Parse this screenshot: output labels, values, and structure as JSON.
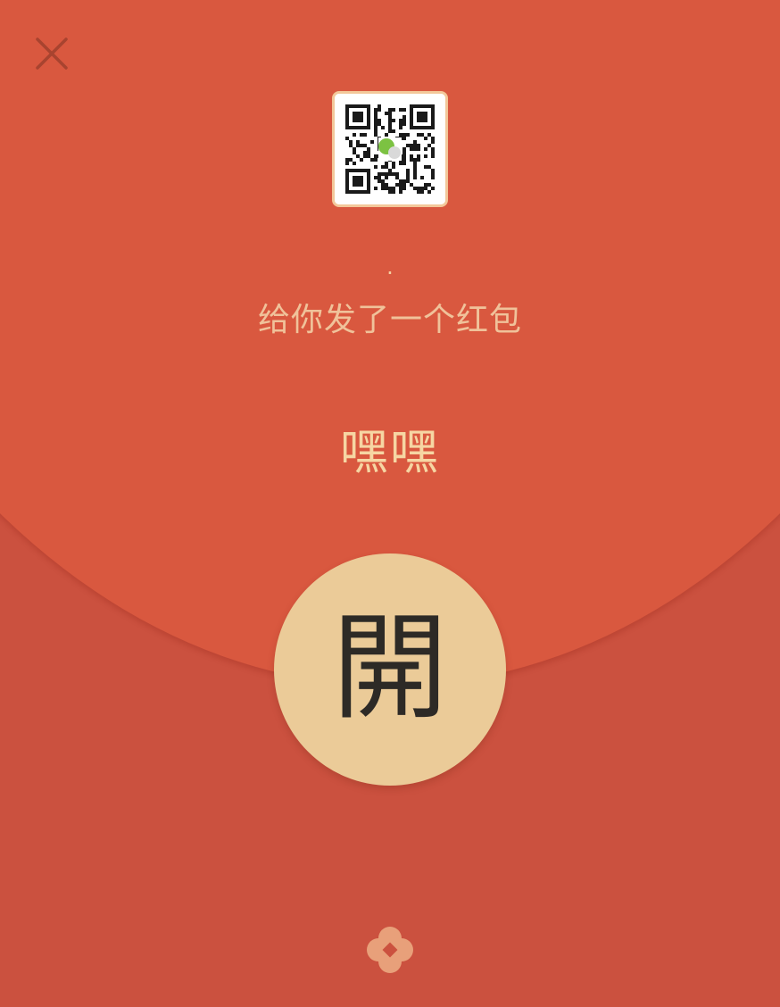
{
  "envelope": {
    "sender_name": "·",
    "subtitle": "给你发了一个红包",
    "greeting": "嘿嘿",
    "open_label": "開"
  },
  "icons": {
    "close": "close-icon",
    "avatar": "qr-code-avatar",
    "logo": "red-packet-logo-icon"
  },
  "colors": {
    "envelope_top": "#d9583f",
    "envelope_bottom": "#cb513f",
    "open_button": "#ebcb98",
    "text_gold": "#f0c29a"
  }
}
